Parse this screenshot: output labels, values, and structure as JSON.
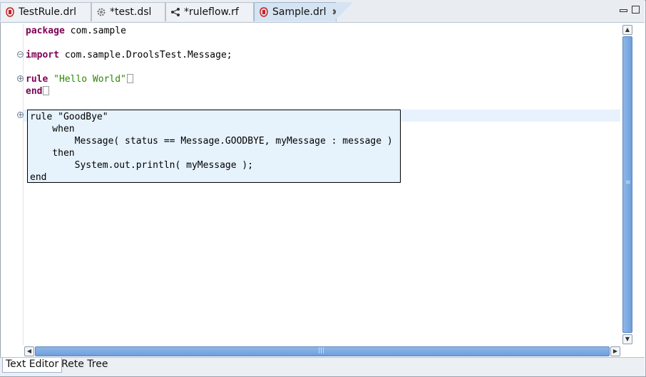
{
  "tabs": [
    {
      "label": "TestRule.drl",
      "icon": "drools-rule-icon"
    },
    {
      "label": "*test.dsl",
      "icon": "gear-icon"
    },
    {
      "label": "*ruleflow.rf",
      "icon": "ruleflow-icon"
    },
    {
      "label": "Sample.drl",
      "icon": "drools-rule-icon",
      "active": true
    }
  ],
  "code": {
    "line1": {
      "kw": "package",
      "rest": " com.sample"
    },
    "line2": {
      "kw": "import",
      "rest": " com.sample.DroolsTest.Message;"
    },
    "line3": {
      "kw": "rule",
      "str": "\"Hello World\""
    },
    "line4": {
      "kw": "end"
    }
  },
  "hover": {
    "lines": [
      "rule \"GoodBye\"",
      "    when",
      "        Message( status == Message.GOODBYE, myMessage : message )",
      "    then",
      "        System.out.println( myMessage );",
      "end"
    ]
  },
  "bottom_tabs": [
    {
      "label": "Text Editor",
      "active": true
    },
    {
      "label": "Rete Tree"
    }
  ]
}
